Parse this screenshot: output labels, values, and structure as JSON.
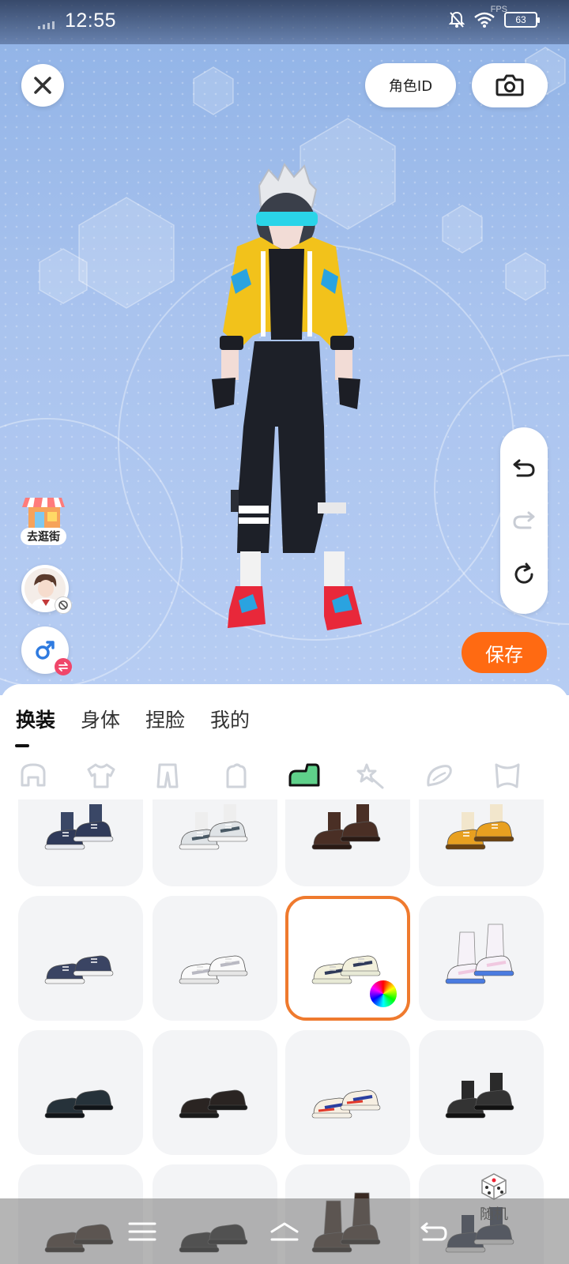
{
  "status_bar": {
    "time": "12:55",
    "fps_label": "FPS",
    "battery": "63"
  },
  "header": {
    "role_id_label": "角色ID"
  },
  "side": {
    "shop_label": "去逛街",
    "random_label": "随机"
  },
  "actions": {
    "save_label": "保存"
  },
  "tabs": [
    {
      "label": "换装",
      "active": true
    },
    {
      "label": "身体",
      "active": false
    },
    {
      "label": "捏脸",
      "active": false
    },
    {
      "label": "我的",
      "active": false
    }
  ],
  "categories": [
    "hair-icon",
    "shirt-icon",
    "pants-icon",
    "glove-icon",
    "shoe-icon",
    "wand-icon",
    "wing-icon",
    "bow-icon"
  ],
  "active_category": "shoe-icon",
  "shoe_grid": [
    {
      "name": "navy-sneakers-with-socks",
      "selected": false
    },
    {
      "name": "gray-white-sneakers",
      "selected": false
    },
    {
      "name": "brown-boots",
      "selected": false
    },
    {
      "name": "orange-boots",
      "selected": false
    },
    {
      "name": "navy-canvas-sneakers",
      "selected": false
    },
    {
      "name": "white-high-tops",
      "selected": false
    },
    {
      "name": "cream-running-shoes",
      "selected": true,
      "recolorable": true
    },
    {
      "name": "white-tall-socks",
      "selected": false
    },
    {
      "name": "black-loafers",
      "selected": false
    },
    {
      "name": "black-derby-shoes",
      "selected": false
    },
    {
      "name": "blue-red-sport-sneakers",
      "selected": false
    },
    {
      "name": "black-ankle-boots",
      "selected": false
    },
    {
      "name": "brown-loafers",
      "selected": false
    },
    {
      "name": "black-oxfords",
      "selected": false
    },
    {
      "name": "brown-tall-boots",
      "selected": false
    },
    {
      "name": "navy-boots",
      "selected": false
    }
  ],
  "colors": {
    "accent": "#ff6a12",
    "selected_border": "#ef7a2e",
    "jacket": "#f2c21b",
    "visor": "#2ad4e8"
  }
}
